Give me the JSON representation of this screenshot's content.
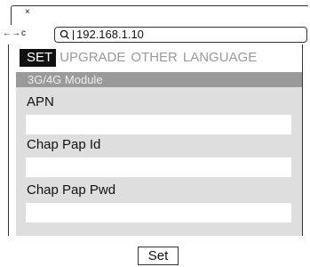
{
  "browser": {
    "tab_close": "×",
    "back": "←",
    "forward": "→",
    "reload": "c",
    "address": "192.168.1.10"
  },
  "menu": {
    "items": [
      {
        "label": "SET",
        "active": true
      },
      {
        "label": "UPGRADE",
        "active": false
      },
      {
        "label": "OTHER",
        "active": false
      },
      {
        "label": "LANGUAGE",
        "active": false
      }
    ]
  },
  "panel": {
    "header": "3G/4G Module",
    "fields": [
      {
        "label": "APN",
        "value": ""
      },
      {
        "label": "Chap Pap Id",
        "value": ""
      },
      {
        "label": "Chap Pap Pwd",
        "value": ""
      }
    ]
  },
  "actions": {
    "set_label": "Set"
  },
  "colors": {
    "panel_bg": "#dedede",
    "header_bg": "#9a9a9a",
    "menu_active_bg": "#111111",
    "menu_inactive_text": "#9a9a9a"
  }
}
